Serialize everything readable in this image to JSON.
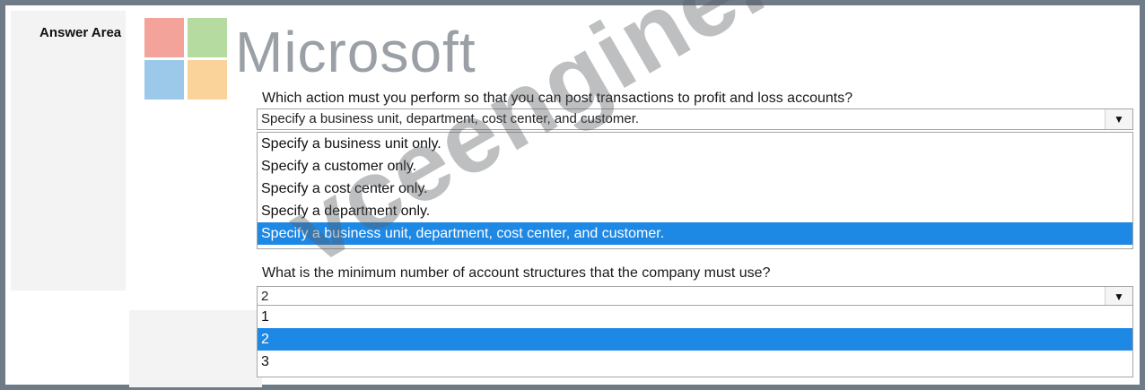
{
  "answer_area": {
    "label": "Answer Area"
  },
  "logo": {
    "word": "Microsoft"
  },
  "question1": {
    "text": "Which action must you perform so that you can post transactions to profit and loss accounts?",
    "selected": "Specify a business unit, department, cost center, and customer.",
    "options": [
      "Specify a business unit only.",
      "Specify a customer only.",
      "Specify a cost center only.",
      "Specify a department only.",
      "Specify a business unit, department, cost center, and customer."
    ],
    "selected_index": 4
  },
  "question2": {
    "text": "What is the minimum number of account structures that the company must use?",
    "selected": "2",
    "options": [
      "1",
      "2",
      "3"
    ],
    "selected_index": 1
  },
  "watermark": {
    "text": "vceengine.com"
  },
  "icons": {
    "dropdown": "chevron-down-icon"
  },
  "colors": {
    "selection": "#1e88e5"
  }
}
